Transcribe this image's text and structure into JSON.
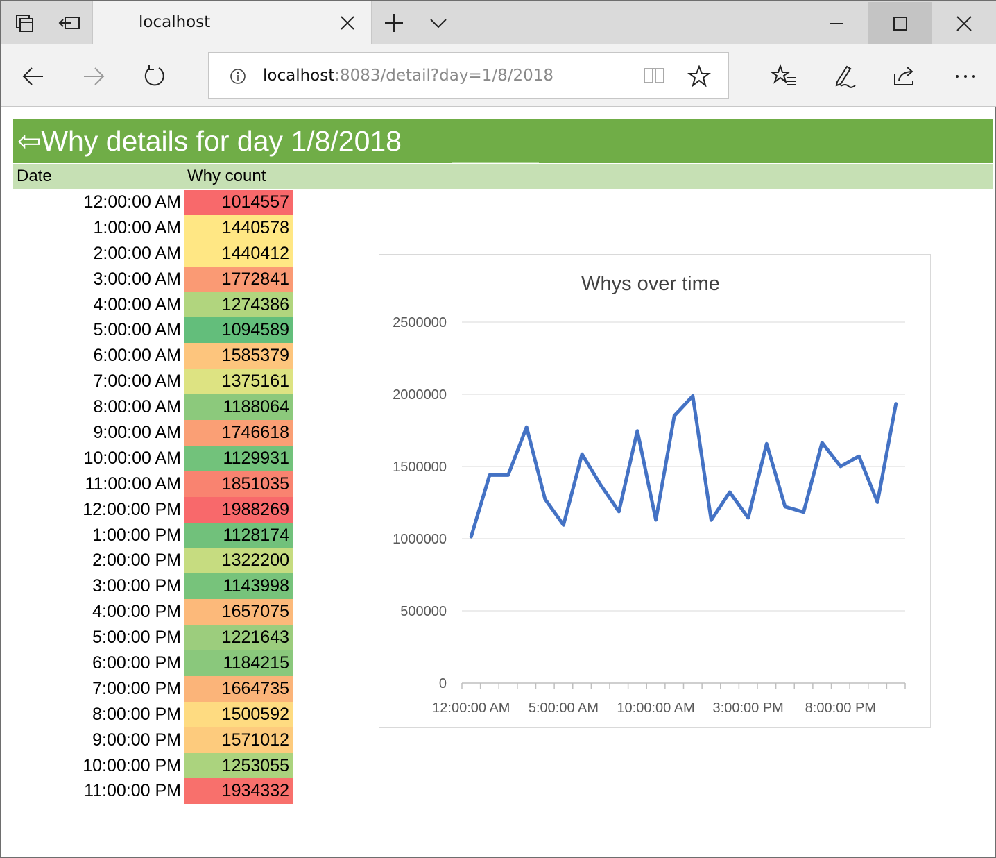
{
  "browser": {
    "tab_title": "localhost",
    "address_host": "localhost",
    "address_path": ":8083/detail?day=1/8/2018",
    "icons": [
      "tab-preview-icon",
      "set-aside-tabs-icon",
      "close-tab-icon",
      "new-tab-icon",
      "tab-list-chevron-icon",
      "minimize-icon",
      "maximize-icon",
      "close-window-icon",
      "back-icon",
      "forward-icon",
      "refresh-icon",
      "site-info-icon",
      "reading-view-icon",
      "favorite-star-icon",
      "favorites-hub-icon",
      "web-note-icon",
      "share-icon",
      "more-icon"
    ]
  },
  "page": {
    "title": "Why details for day 1/8/2018",
    "back_arrow": "⇦",
    "columns": {
      "date": "Date",
      "count": "Why count"
    },
    "rows": [
      {
        "date": "12:00:00 AM",
        "count": "1014557",
        "color": "#f8696b"
      },
      {
        "date": "1:00:00 AM",
        "count": "1440578",
        "color": "#ffe784"
      },
      {
        "date": "2:00:00 AM",
        "count": "1440412",
        "color": "#ffe784"
      },
      {
        "date": "3:00:00 AM",
        "count": "1772841",
        "color": "#fa9a74"
      },
      {
        "date": "4:00:00 AM",
        "count": "1274386",
        "color": "#b1d57e"
      },
      {
        "date": "5:00:00 AM",
        "count": "1094589",
        "color": "#63be7b"
      },
      {
        "date": "6:00:00 AM",
        "count": "1585379",
        "color": "#fdc57d"
      },
      {
        "date": "7:00:00 AM",
        "count": "1375161",
        "color": "#dde382"
      },
      {
        "date": "8:00:00 AM",
        "count": "1188064",
        "color": "#8cc97c"
      },
      {
        "date": "9:00:00 AM",
        "count": "1746618",
        "color": "#fa9f75"
      },
      {
        "date": "10:00:00 AM",
        "count": "1129931",
        "color": "#72c27b"
      },
      {
        "date": "11:00:00 AM",
        "count": "1851035",
        "color": "#f98370"
      },
      {
        "date": "12:00:00 PM",
        "count": "1988269",
        "color": "#f8696b"
      },
      {
        "date": "1:00:00 PM",
        "count": "1128174",
        "color": "#71c17b"
      },
      {
        "date": "2:00:00 PM",
        "count": "1322200",
        "color": "#c6dc80"
      },
      {
        "date": "3:00:00 PM",
        "count": "1143998",
        "color": "#77c37b"
      },
      {
        "date": "4:00:00 PM",
        "count": "1657075",
        "color": "#fcb97a"
      },
      {
        "date": "5:00:00 PM",
        "count": "1221643",
        "color": "#9ccd7d"
      },
      {
        "date": "6:00:00 PM",
        "count": "1184215",
        "color": "#8ac87c"
      },
      {
        "date": "7:00:00 PM",
        "count": "1664735",
        "color": "#fbb479"
      },
      {
        "date": "8:00:00 PM",
        "count": "1500592",
        "color": "#fedb81"
      },
      {
        "date": "9:00:00 PM",
        "count": "1571012",
        "color": "#fdcb7d"
      },
      {
        "date": "10:00:00 PM",
        "count": "1253055",
        "color": "#abd37e"
      },
      {
        "date": "11:00:00 PM",
        "count": "1934332",
        "color": "#f8706c"
      }
    ]
  },
  "chart_data": {
    "type": "line",
    "title": "Whys over time",
    "xlabel": "",
    "ylabel": "",
    "ylim": [
      0,
      2500000
    ],
    "yticks": [
      "2500000",
      "2000000",
      "1500000",
      "1000000",
      "500000",
      "0"
    ],
    "xtick_labels": [
      "12:00:00 AM",
      "5:00:00 AM",
      "10:00:00 AM",
      "3:00:00 PM",
      "8:00:00 PM"
    ],
    "grid": true,
    "legend": "none",
    "line_color": "#4472c4",
    "categories": [
      "12:00:00 AM",
      "1:00:00 AM",
      "2:00:00 AM",
      "3:00:00 AM",
      "4:00:00 AM",
      "5:00:00 AM",
      "6:00:00 AM",
      "7:00:00 AM",
      "8:00:00 AM",
      "9:00:00 AM",
      "10:00:00 AM",
      "11:00:00 AM",
      "12:00:00 PM",
      "1:00:00 PM",
      "2:00:00 PM",
      "3:00:00 PM",
      "4:00:00 PM",
      "5:00:00 PM",
      "6:00:00 PM",
      "7:00:00 PM",
      "8:00:00 PM",
      "9:00:00 PM",
      "10:00:00 PM",
      "11:00:00 PM"
    ],
    "values": [
      1014557,
      1440578,
      1440412,
      1772841,
      1274386,
      1094589,
      1585379,
      1375161,
      1188064,
      1746618,
      1129931,
      1851035,
      1988269,
      1128174,
      1322200,
      1143998,
      1657075,
      1221643,
      1184215,
      1664735,
      1500592,
      1571012,
      1253055,
      1934332
    ]
  }
}
